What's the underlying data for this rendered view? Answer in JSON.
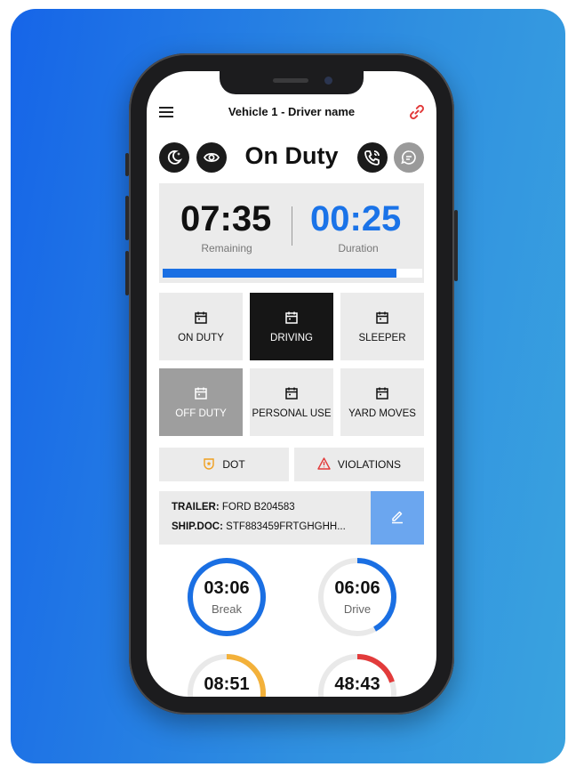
{
  "header": {
    "title": "Vehicle 1 - Driver name"
  },
  "status": {
    "title": "On Duty"
  },
  "timer": {
    "remaining_value": "07:35",
    "remaining_label": "Remaining",
    "duration_value": "00:25",
    "duration_label": "Duration",
    "progress_fraction": 0.9
  },
  "status_tiles": {
    "on_duty": "ON DUTY",
    "driving": "DRIVING",
    "sleeper": "SLEEPER",
    "off_duty": "OFF DUTY",
    "personal_use": "PERSONAL USE",
    "yard_moves": "YARD MOVES"
  },
  "actions": {
    "dot": "DOT",
    "violations": "VIOLATIONS"
  },
  "info": {
    "trailer_label": "TRAILER:",
    "trailer_value": "FORD B204583",
    "shipdoc_label": "SHIP.DOC:",
    "shipdoc_value": "STF883459FRTGHGHH..."
  },
  "rings": [
    {
      "time": "03:06",
      "label": "Break",
      "fraction": 1.0,
      "color": "#1a6fe3"
    },
    {
      "time": "06:06",
      "label": "Drive",
      "fraction": 0.42,
      "color": "#1a6fe3"
    },
    {
      "time": "08:51",
      "label": "",
      "fraction": 0.34,
      "color": "#f3b13a"
    },
    {
      "time": "48:43",
      "label": "",
      "fraction": 0.2,
      "color": "#e23b3b"
    }
  ],
  "colors": {
    "accent_blue": "#1a6fe3",
    "duration_blue": "#1a73e8",
    "background_gradient_start": "#1665e8",
    "background_gradient_end": "#3aa3df",
    "link_red": "#e23b3b"
  },
  "icons": {
    "menu": "hamburger-icon",
    "link": "link-icon",
    "night": "moon-icon",
    "view": "eye-icon",
    "call": "phone-icon",
    "chat": "chat-icon",
    "tile": "calendar-icon",
    "dot": "badge-icon",
    "violations": "warning-icon",
    "edit": "pencil-icon"
  }
}
